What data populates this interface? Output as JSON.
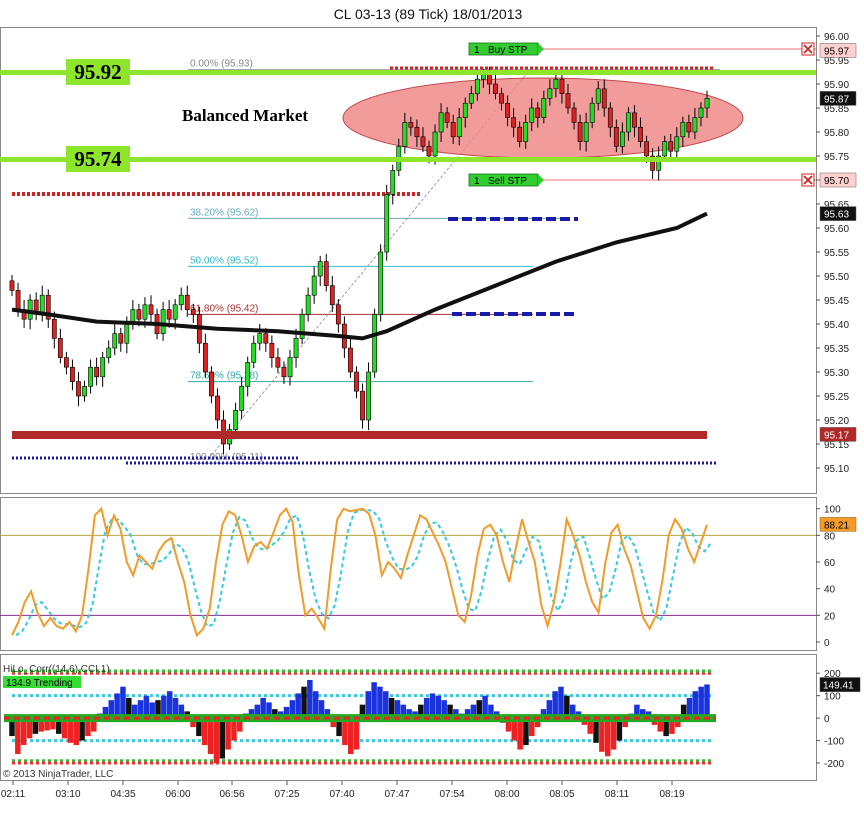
{
  "window": {
    "title": "CL 03-13 (89 Tick)  18/01/2013"
  },
  "copyright": "© 2013 NinjaTrader, LLC",
  "colors": {
    "up_candle": "#22dd22",
    "down_candle": "#dd2222",
    "level_line": "#8ee62c",
    "ma_line": "#111111",
    "stoch_k": "#f29b28",
    "stoch_d": "#33ccdd",
    "balanced_ellipse": "#f08a8a",
    "support_bar": "#b02828",
    "blue_dots": "#1a1aa8",
    "red_dots": "#cc2222"
  },
  "chart_data": [
    {
      "type": "candlestick",
      "title": "CL 03-13 (89 Tick)  18/01/2013",
      "ylim": [
        95.08,
        96.0
      ],
      "y_ticks": [
        "96.00",
        "95.95",
        "95.90",
        "95.85",
        "95.80",
        "95.75",
        "95.70",
        "95.65",
        "95.60",
        "95.55",
        "95.50",
        "95.45",
        "95.40",
        "95.35",
        "95.30",
        "95.25",
        "95.20",
        "95.15",
        "95.10"
      ],
      "x_ticks": [
        "02:11",
        "03:10",
        "04:35",
        "06:00",
        "06:56",
        "07:25",
        "07:40",
        "07:47",
        "07:54",
        "08:00",
        "08:05",
        "08:11",
        "08:19"
      ],
      "close": [
        95.47,
        95.43,
        95.41,
        95.45,
        95.42,
        95.46,
        95.41,
        95.37,
        95.33,
        95.31,
        95.28,
        95.25,
        95.27,
        95.31,
        95.29,
        95.33,
        95.35,
        95.38,
        95.36,
        95.4,
        95.43,
        95.41,
        95.44,
        95.42,
        95.38,
        95.43,
        95.41,
        95.44,
        95.46,
        95.43,
        95.42,
        95.36,
        95.3,
        95.25,
        95.2,
        95.15,
        95.18,
        95.22,
        95.27,
        95.32,
        95.36,
        95.38,
        95.36,
        95.33,
        95.31,
        95.29,
        95.33,
        95.37,
        95.42,
        95.46,
        95.5,
        95.53,
        95.48,
        95.44,
        95.4,
        95.35,
        95.3,
        95.26,
        95.2,
        95.3,
        95.42,
        95.55,
        95.67,
        95.72,
        95.77,
        95.82,
        95.81,
        95.79,
        95.77,
        95.75,
        95.8,
        95.84,
        95.82,
        95.79,
        95.83,
        95.86,
        95.88,
        95.91,
        95.92,
        95.9,
        95.88,
        95.86,
        95.83,
        95.81,
        95.78,
        95.82,
        95.85,
        95.83,
        95.87,
        95.89,
        95.91,
        95.88,
        95.85,
        95.82,
        95.78,
        95.82,
        95.86,
        95.89,
        95.85,
        95.81,
        95.77,
        95.8,
        95.84,
        95.81,
        95.78,
        95.75,
        95.72,
        95.75,
        95.78,
        95.76,
        95.79,
        95.82,
        95.8,
        95.83,
        95.85,
        95.87
      ],
      "support": 95.17,
      "price_labels": [
        "95.97",
        "95.87",
        "95.70",
        "95.63",
        "95.17"
      ],
      "ma_series": [
        {
          "x": 0,
          "y": 95.43
        },
        {
          "x": 6,
          "y": 95.42
        },
        {
          "x": 14,
          "y": 95.405
        },
        {
          "x": 24,
          "y": 95.4
        },
        {
          "x": 34,
          "y": 95.39
        },
        {
          "x": 44,
          "y": 95.385
        },
        {
          "x": 54,
          "y": 95.375
        },
        {
          "x": 58,
          "y": 95.37
        },
        {
          "x": 62,
          "y": 95.385
        },
        {
          "x": 70,
          "y": 95.43
        },
        {
          "x": 80,
          "y": 95.48
        },
        {
          "x": 90,
          "y": 95.53
        },
        {
          "x": 100,
          "y": 95.57
        },
        {
          "x": 110,
          "y": 95.6
        },
        {
          "x": 115,
          "y": 95.63
        }
      ]
    },
    {
      "type": "line",
      "title": "Stochastics",
      "ylim": [
        -6,
        108
      ],
      "y_ticks": [
        "100",
        "80",
        "60",
        "40",
        "20",
        "0"
      ],
      "levels": [
        20,
        80
      ],
      "value_label": "88.21",
      "series": [
        {
          "name": "",
          "values": [
            5,
            15,
            30,
            38,
            22,
            12,
            18,
            12,
            10,
            15,
            8,
            20,
            55,
            95,
            100,
            80,
            95,
            85,
            60,
            50,
            65,
            60,
            55,
            68,
            75,
            78,
            60,
            45,
            20,
            5,
            10,
            25,
            60,
            88,
            98,
            95,
            80,
            60,
            72,
            75,
            70,
            82,
            95,
            100,
            90,
            50,
            20,
            25,
            18,
            10,
            55,
            92,
            100,
            98,
            99,
            100,
            96,
            80,
            50,
            60,
            55,
            48,
            65,
            80,
            95,
            92,
            82,
            72,
            60,
            40,
            20,
            15,
            35,
            65,
            85,
            88,
            80,
            60,
            45,
            70,
            92,
            75,
            60,
            28,
            12,
            30,
            58,
            92,
            80,
            65,
            45,
            30,
            22,
            58,
            82,
            88,
            70,
            58,
            38,
            18,
            10,
            20,
            46,
            80,
            92,
            85,
            70,
            60,
            74,
            88
          ]
        }
      ]
    },
    {
      "type": "bar",
      "title": "HiLo_Corr((14,6),CCI,1)",
      "status": "134.9 Trending",
      "ylim": [
        -240,
        250
      ],
      "y_ticks": [
        "200",
        "100",
        "0",
        "-100",
        "-200"
      ],
      "value_label": "149.41",
      "values": [
        -80,
        -160,
        -120,
        -90,
        -70,
        -60,
        -55,
        -50,
        -70,
        -90,
        -110,
        -120,
        -100,
        -80,
        -60,
        20,
        50,
        80,
        110,
        140,
        90,
        60,
        80,
        100,
        70,
        80,
        100,
        120,
        90,
        60,
        30,
        -40,
        -80,
        -120,
        -160,
        -200,
        -180,
        -140,
        -100,
        -60,
        20,
        40,
        60,
        90,
        70,
        40,
        30,
        50,
        80,
        110,
        140,
        170,
        120,
        80,
        40,
        -40,
        -80,
        -120,
        -160,
        -140,
        60,
        120,
        160,
        140,
        120,
        90,
        80,
        60,
        40,
        30,
        60,
        90,
        110,
        100,
        80,
        60,
        40,
        20,
        40,
        60,
        80,
        100,
        60,
        30,
        -20,
        -60,
        -100,
        -140,
        -120,
        -80,
        -40,
        40,
        80,
        120,
        140,
        100,
        60,
        30,
        -30,
        -70,
        -110,
        -150,
        -170,
        -140,
        -100,
        -40,
        20,
        60,
        40,
        30,
        -30,
        -60,
        -80,
        -70,
        -40,
        60,
        90,
        120,
        140,
        150
      ]
    }
  ],
  "annotations": {
    "balanced_market": "Balanced Market",
    "level_high": "95.92",
    "level_low": "95.74",
    "buy_stop_qty": "1",
    "buy_stop_label": "Buy STP",
    "sell_stop_qty": "1",
    "sell_stop_label": "Sell STP",
    "fib_0": "0.00% (95.93)",
    "fib_382": "38.20% (95.62)",
    "fib_50": "50.00% (95.52)",
    "fib_618": "61.80% (95.42)",
    "fib_786": "78.60% (95.28)",
    "fib_100": "100.00% (95.11)"
  }
}
